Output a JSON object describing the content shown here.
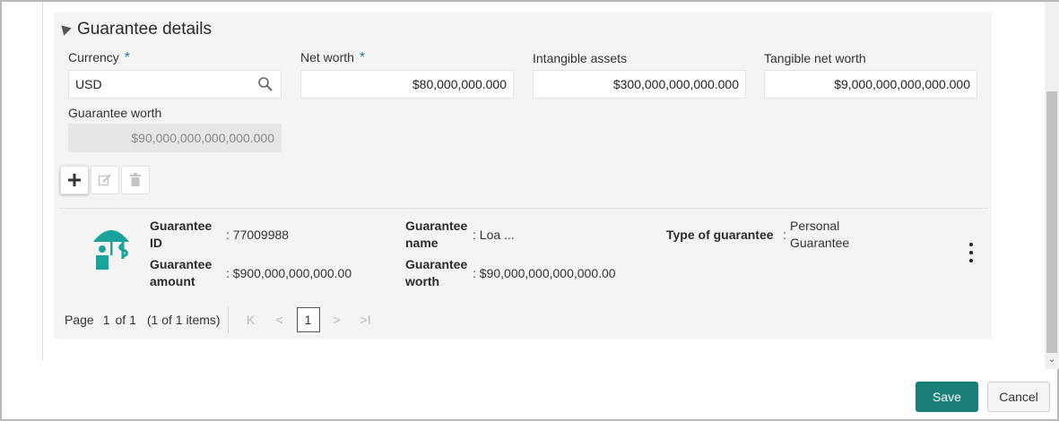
{
  "section": {
    "title": "Guarantee details"
  },
  "fields": {
    "currency": {
      "label": "Currency",
      "required": "*",
      "value": "USD"
    },
    "net_worth": {
      "label": "Net worth",
      "required": "*",
      "value": "$80,000,000.000"
    },
    "intangible_assets": {
      "label": "Intangible assets",
      "value": "$300,000,000,000.000"
    },
    "tangible_net_worth": {
      "label": "Tangible net worth",
      "value": "$9,000,000,000,000.000"
    },
    "guarantee_worth": {
      "label": "Guarantee worth",
      "value": "$90,000,000,000,000.000"
    }
  },
  "toolbar": {
    "add_icon": "plus-icon",
    "edit_icon": "edit-icon",
    "delete_icon": "trash-icon"
  },
  "card": {
    "icon": "guarantee-umbrella-icon",
    "id_label_1": "Guarantee",
    "id_label_2": "ID",
    "id_value": ": 77009988",
    "name_label_1": "Guarantee",
    "name_label_2": "name",
    "name_value": ": Loa ...",
    "type_label": "Type of guarantee",
    "type_sep": ":",
    "type_value_1": "Personal",
    "type_value_2": "Guarantee",
    "amount_label_1": "Guarantee",
    "amount_label_2": "amount",
    "amount_value": ": $900,000,000,000.00",
    "worth_label_1": "Guarantee",
    "worth_label_2": "worth",
    "worth_value": ": $90,000,000,000,000.00"
  },
  "pager": {
    "page_label": "Page",
    "current": "1",
    "of_label": "of 1",
    "items_label": "(1 of 1 items)",
    "first": "K",
    "prev": "<",
    "page_number": "1",
    "next": ">",
    "last": ">I"
  },
  "footer": {
    "save_label": "Save",
    "cancel_label": "Cancel"
  },
  "colors": {
    "accent": "#1a7f78",
    "icon": "#1aa39a",
    "required": "#1f7aa8"
  }
}
